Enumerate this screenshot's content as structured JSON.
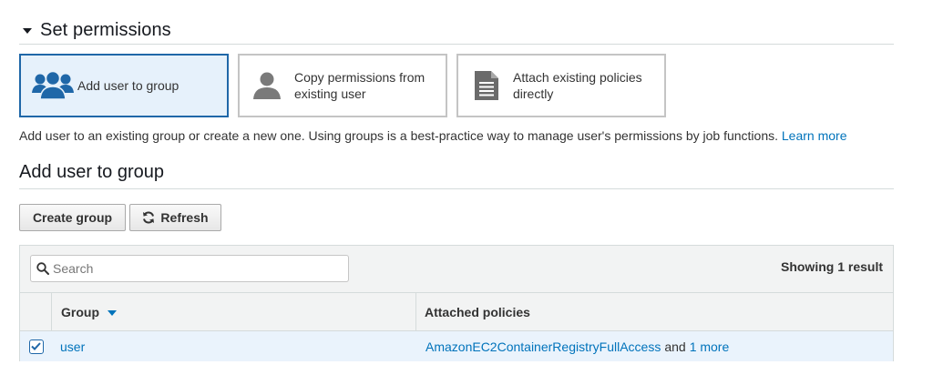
{
  "section": {
    "title": "Set permissions"
  },
  "options": [
    {
      "label": "Add user to group",
      "icon": "users-group-icon",
      "selected": true
    },
    {
      "label": "Copy permissions from existing user",
      "icon": "user-icon",
      "selected": false
    },
    {
      "label": "Attach existing policies directly",
      "icon": "document-icon",
      "selected": false
    }
  ],
  "description": {
    "text": "Add user to an existing group or create a new one. Using groups is a best-practice way to manage user's permissions by job functions.",
    "link": "Learn more"
  },
  "group_section": {
    "title": "Add user to group",
    "create_label": "Create group",
    "refresh_label": "Refresh"
  },
  "table": {
    "search_placeholder": "Search",
    "result_count": "Showing 1 result",
    "columns": [
      "Group",
      "Attached policies"
    ],
    "rows": [
      {
        "checked": true,
        "group": "user",
        "policy": "AmazonEC2ContainerRegistryFullAccess",
        "and_text": "and",
        "more": "1 more"
      }
    ]
  },
  "colors": {
    "accent": "#1f67a8",
    "link": "#0073bb",
    "selected_bg": "#e6f1fb"
  }
}
